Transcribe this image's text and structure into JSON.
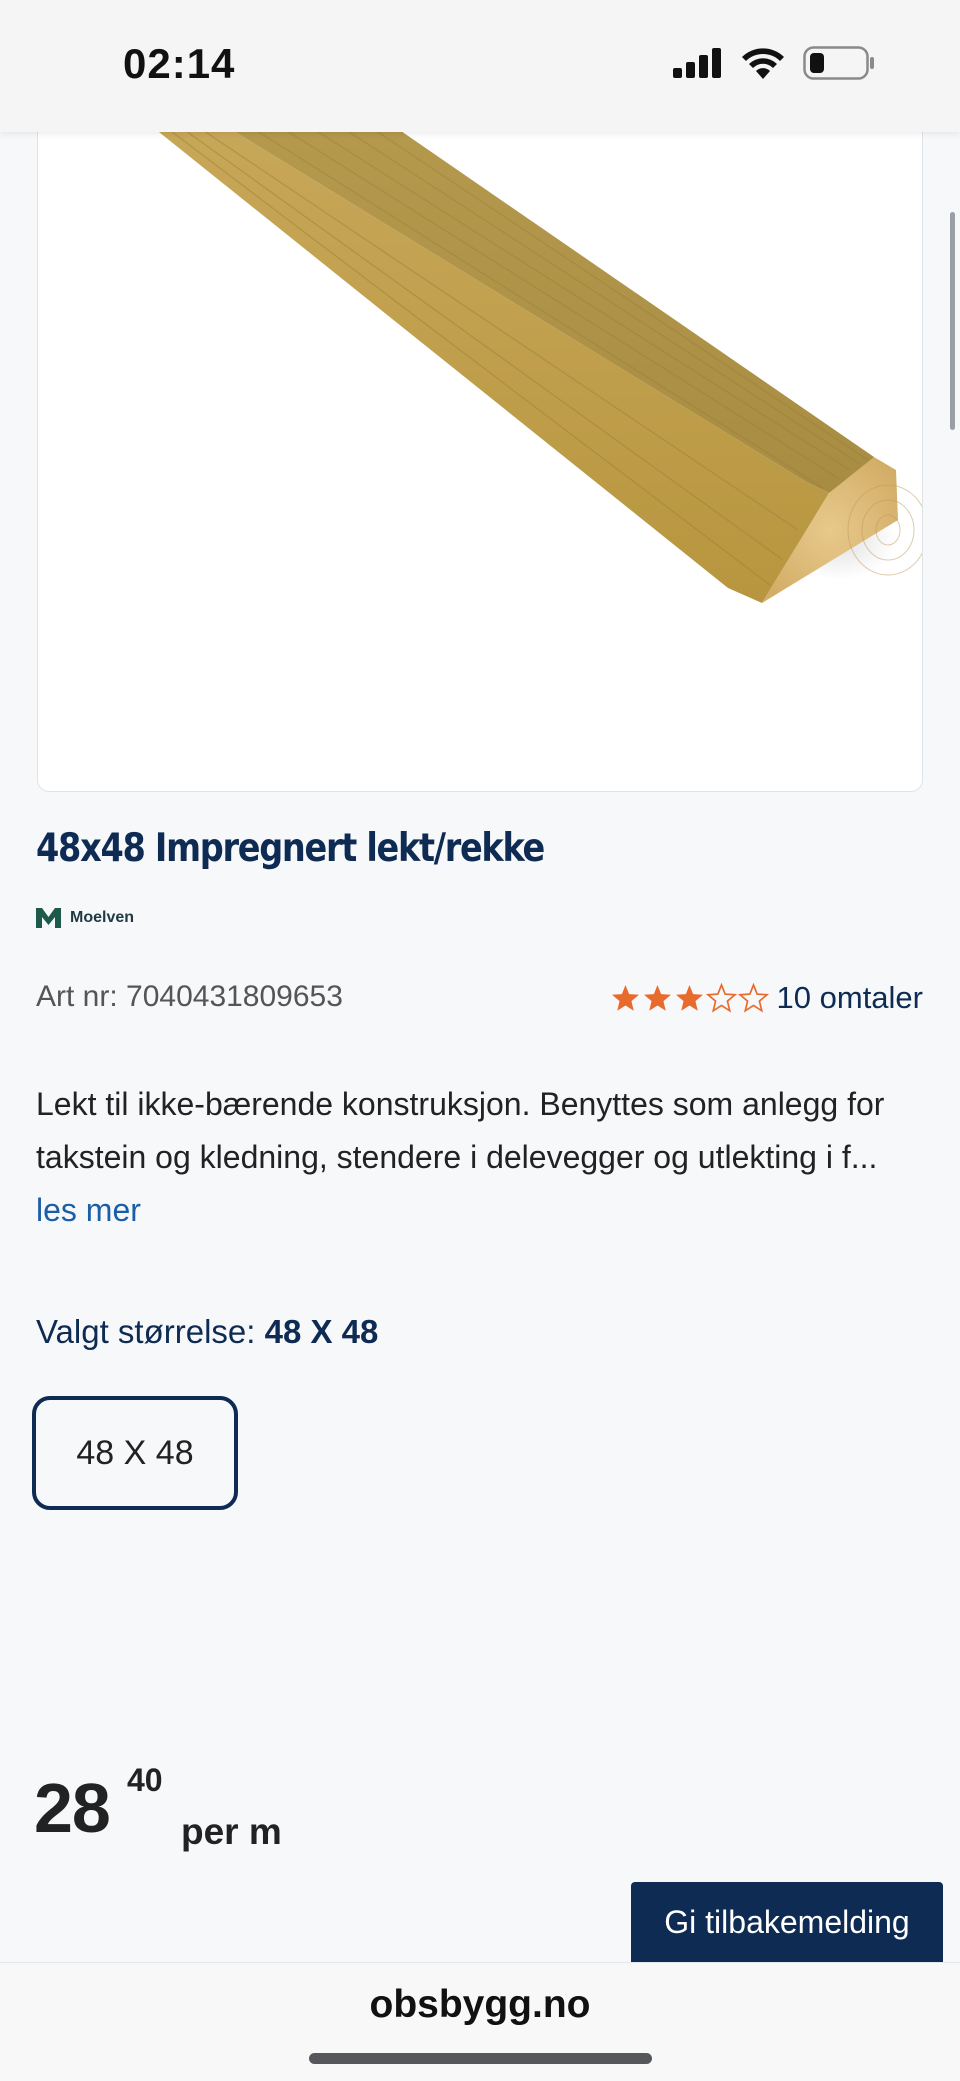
{
  "status_bar": {
    "time": "02:14"
  },
  "product": {
    "title": "48x48 Impregnert lekt/rekke",
    "brand": "Moelven",
    "art_nr_label": "Art nr: 7040431809653",
    "rating": {
      "value": 3,
      "max": 5,
      "reviews_label": "10 omtaler",
      "star_color": "#e86a2c"
    },
    "description": "Lekt til ikke-bærende konstruksjon. Benyttes som anlegg for takstein og kledning, stendere i delevegger og utlekting i f...",
    "read_more": "les mer",
    "size_label": "Valgt størrelse:",
    "size_value": "48 X 48",
    "size_options": [
      "48 X 48"
    ],
    "price": {
      "main": "28",
      "decimals": "40",
      "unit": "per m"
    }
  },
  "feedback_button": "Gi tilbakemelding",
  "browser": {
    "url": "obsbygg.no"
  },
  "colors": {
    "brand_navy": "#0e2b53",
    "link_blue": "#1b5ea8",
    "star_orange": "#e86a2c"
  }
}
